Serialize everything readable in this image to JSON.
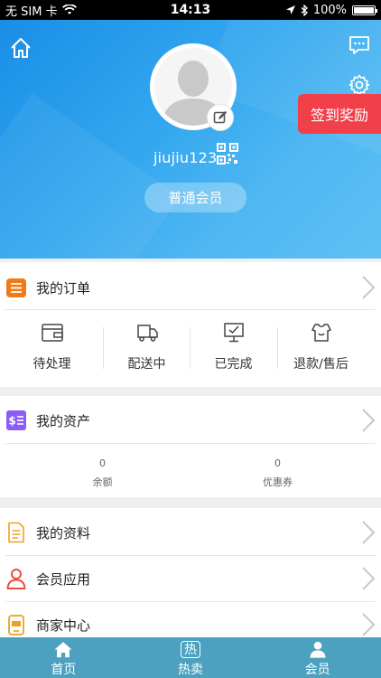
{
  "status_bar": {
    "carrier": "无 SIM 卡",
    "time": "14:13",
    "battery": "100%"
  },
  "profile": {
    "username": "jiujiu123",
    "member_level": "普通会员",
    "signin_reward": "签到奖励"
  },
  "orders": {
    "title": "我的订单",
    "statuses": [
      {
        "label": "待处理",
        "icon": "wallet-icon"
      },
      {
        "label": "配送中",
        "icon": "truck-icon"
      },
      {
        "label": "已完成",
        "icon": "monitor-check-icon"
      },
      {
        "label": "退款/售后",
        "icon": "shirt-icon"
      }
    ]
  },
  "assets": {
    "title": "我的资产",
    "items": [
      {
        "value": "0",
        "label": "余额"
      },
      {
        "value": "0",
        "label": "优惠券"
      }
    ]
  },
  "menu": [
    {
      "label": "我的资料",
      "icon": "document-icon"
    },
    {
      "label": "会员应用",
      "icon": "person-icon"
    },
    {
      "label": "商家中心",
      "icon": "store-icon"
    }
  ],
  "tabbar": {
    "items": [
      {
        "label": "首页",
        "icon": "home-icon"
      },
      {
        "label": "热卖",
        "icon": "hot-icon",
        "icon_text": "热"
      },
      {
        "label": "会员",
        "icon": "member-icon"
      }
    ]
  },
  "colors": {
    "header_blue": "#2f9fe8",
    "signin_red": "#f2404a",
    "tabbar": "#4da1c0",
    "orders_icon": "#f07a1a",
    "assets_icon": "#8b5cf6",
    "profile_icon": "#f0a020",
    "member_icon": "#e8523a"
  }
}
